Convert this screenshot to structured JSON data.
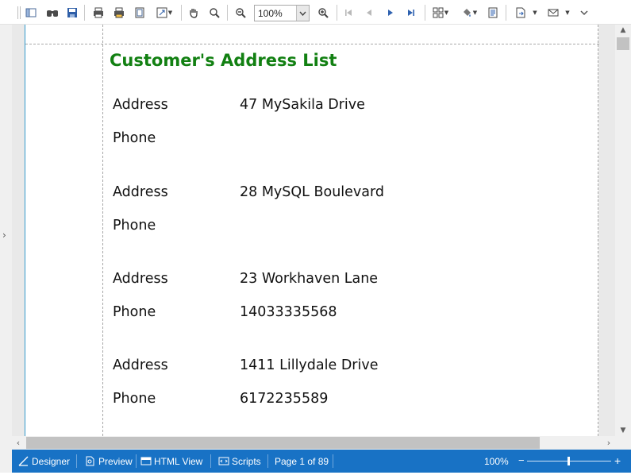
{
  "toolbar": {
    "zoom_value": "100%",
    "tools": [
      {
        "name": "toggle-panel",
        "glyph": "▯"
      },
      {
        "name": "find",
        "glyph": "⚭"
      },
      {
        "name": "save",
        "glyph": "▣"
      },
      {
        "name": "print",
        "glyph": "⎙"
      },
      {
        "name": "quick-print",
        "glyph": "⎙"
      },
      {
        "name": "page-setup",
        "glyph": "▢"
      },
      {
        "name": "scale",
        "glyph": "⤡"
      },
      {
        "name": "hand-tool",
        "glyph": "✋"
      },
      {
        "name": "magnifier",
        "glyph": "⌕"
      },
      {
        "name": "zoom-out",
        "glyph": "⊖"
      },
      {
        "name": "zoom-in",
        "glyph": "⊕"
      },
      {
        "name": "first-page",
        "glyph": "⏮"
      },
      {
        "name": "previous-page",
        "glyph": "◀"
      },
      {
        "name": "next-page",
        "glyph": "▶"
      },
      {
        "name": "last-page",
        "glyph": "⏭"
      },
      {
        "name": "multiple-pages",
        "glyph": "▦"
      },
      {
        "name": "page-color",
        "glyph": "◈"
      },
      {
        "name": "watermark",
        "glyph": "▤"
      },
      {
        "name": "export",
        "glyph": "⎘"
      },
      {
        "name": "send-email",
        "glyph": "✉"
      },
      {
        "name": "more",
        "glyph": "⌄"
      }
    ]
  },
  "report": {
    "title": "Customer's Address List",
    "records": [
      {
        "address_label": "Address",
        "address": "47 MySakila Drive",
        "phone_label": "Phone",
        "phone": ""
      },
      {
        "address_label": "Address",
        "address": "28 MySQL Boulevard",
        "phone_label": "Phone",
        "phone": ""
      },
      {
        "address_label": "Address",
        "address": "23 Workhaven Lane",
        "phone_label": "Phone",
        "phone": "14033335568"
      },
      {
        "address_label": "Address",
        "address": "1411 Lillydale Drive",
        "phone_label": "Phone",
        "phone": "6172235589"
      }
    ]
  },
  "statusbar": {
    "designer": "Designer",
    "preview": "Preview",
    "html_view": "HTML View",
    "scripts": "Scripts",
    "page_info": "Page 1 of 89",
    "zoom": "100%",
    "zoom_minus": "−",
    "zoom_plus": "+"
  },
  "colors": {
    "title_green": "#128012",
    "statusbar_blue": "#1872c5",
    "page_border_blue": "#3399cc"
  }
}
